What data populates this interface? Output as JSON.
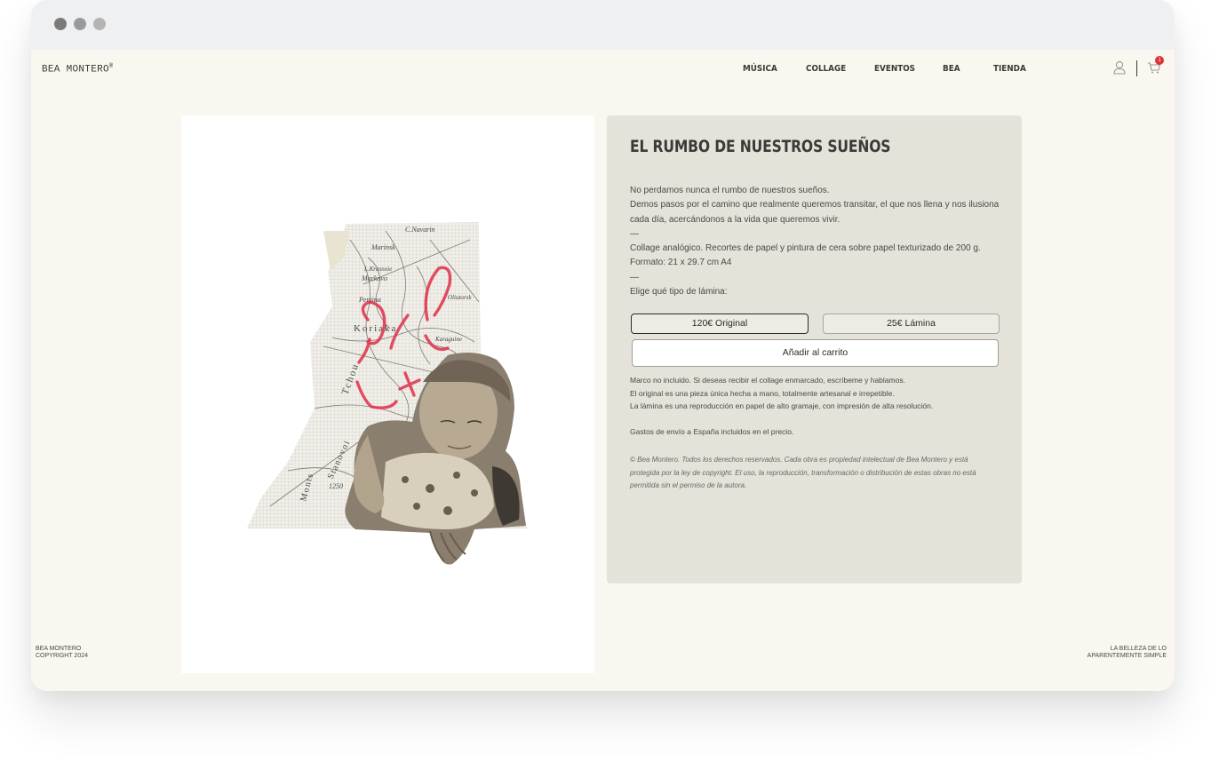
{
  "header": {
    "logo": "BEA MONTERO",
    "logo_mark": "®",
    "nav": [
      {
        "label": "MÚSICA"
      },
      {
        "label": "COLLAGE"
      },
      {
        "label": "EVENTOS"
      },
      {
        "label": "BEA"
      },
      {
        "label": "TIENDA"
      }
    ],
    "cart_count": "1",
    "icons": [
      "user-icon",
      "cart-icon"
    ]
  },
  "product": {
    "title": "EL RUMBO DE NUESTROS SUEÑOS",
    "description": [
      "No perdamos nunca el rumbo de nuestros sueños.",
      "Demos pasos por el camino que realmente queremos transitar, el que nos llena y nos ilusiona cada día, acercándonos a la vida que queremos vivir.",
      "—",
      "Collage analógico. Recortes de papel y pintura de cera sobre papel texturizado de 200 g.",
      "Formato: 21 x 29.7 cm A4",
      "—",
      "Elige qué tipo de lámina:"
    ],
    "options": [
      {
        "label": "120€ Original",
        "selected": true
      },
      {
        "label": "25€ Lámina",
        "selected": false
      }
    ],
    "add_to_cart": "Añadir al carrito",
    "notes": [
      "Marco no incluido. Si deseas recibir el collage enmarcado, escríbeme y hablamos.",
      "El original es una pieza única hecha a mano, totalmente artesanal e irrepetible.",
      "La lámina es una reproducción en papel de alto gramaje, con impresión de alta resolución."
    ],
    "shipping": "Gastos de envío a España incluidos en el precio.",
    "copyright": "© Bea Montero. Todos los derechos reservados. Cada obra es propiedad intelectual de Bea Montero y está protegida por la ley de copyright. El uso, la reproducción, transformación o distribución de estas obras no está permitida sin el permiso de la autora.",
    "map_labels": [
      "C.Navarin",
      "Marinsk",
      "L.Krasnoie",
      "Markovo",
      "Penjina",
      "Koriaka",
      "Karaguine",
      "Tchou",
      "Monts",
      "Stanovoi",
      "Oliutorsk",
      "1250"
    ]
  },
  "footer": {
    "left_line1": "BEA MONTERO",
    "left_line2": "COPYRIGHT 2024",
    "right_line1": "LA BELLEZA DE LO",
    "right_line2": "APARENTEMENTE SIMPLE"
  },
  "colors": {
    "page_bg": "#f9f7f0",
    "panel_bg": "#e4e2d9",
    "text": "#3b3a36",
    "accent_red": "#e0303a"
  }
}
